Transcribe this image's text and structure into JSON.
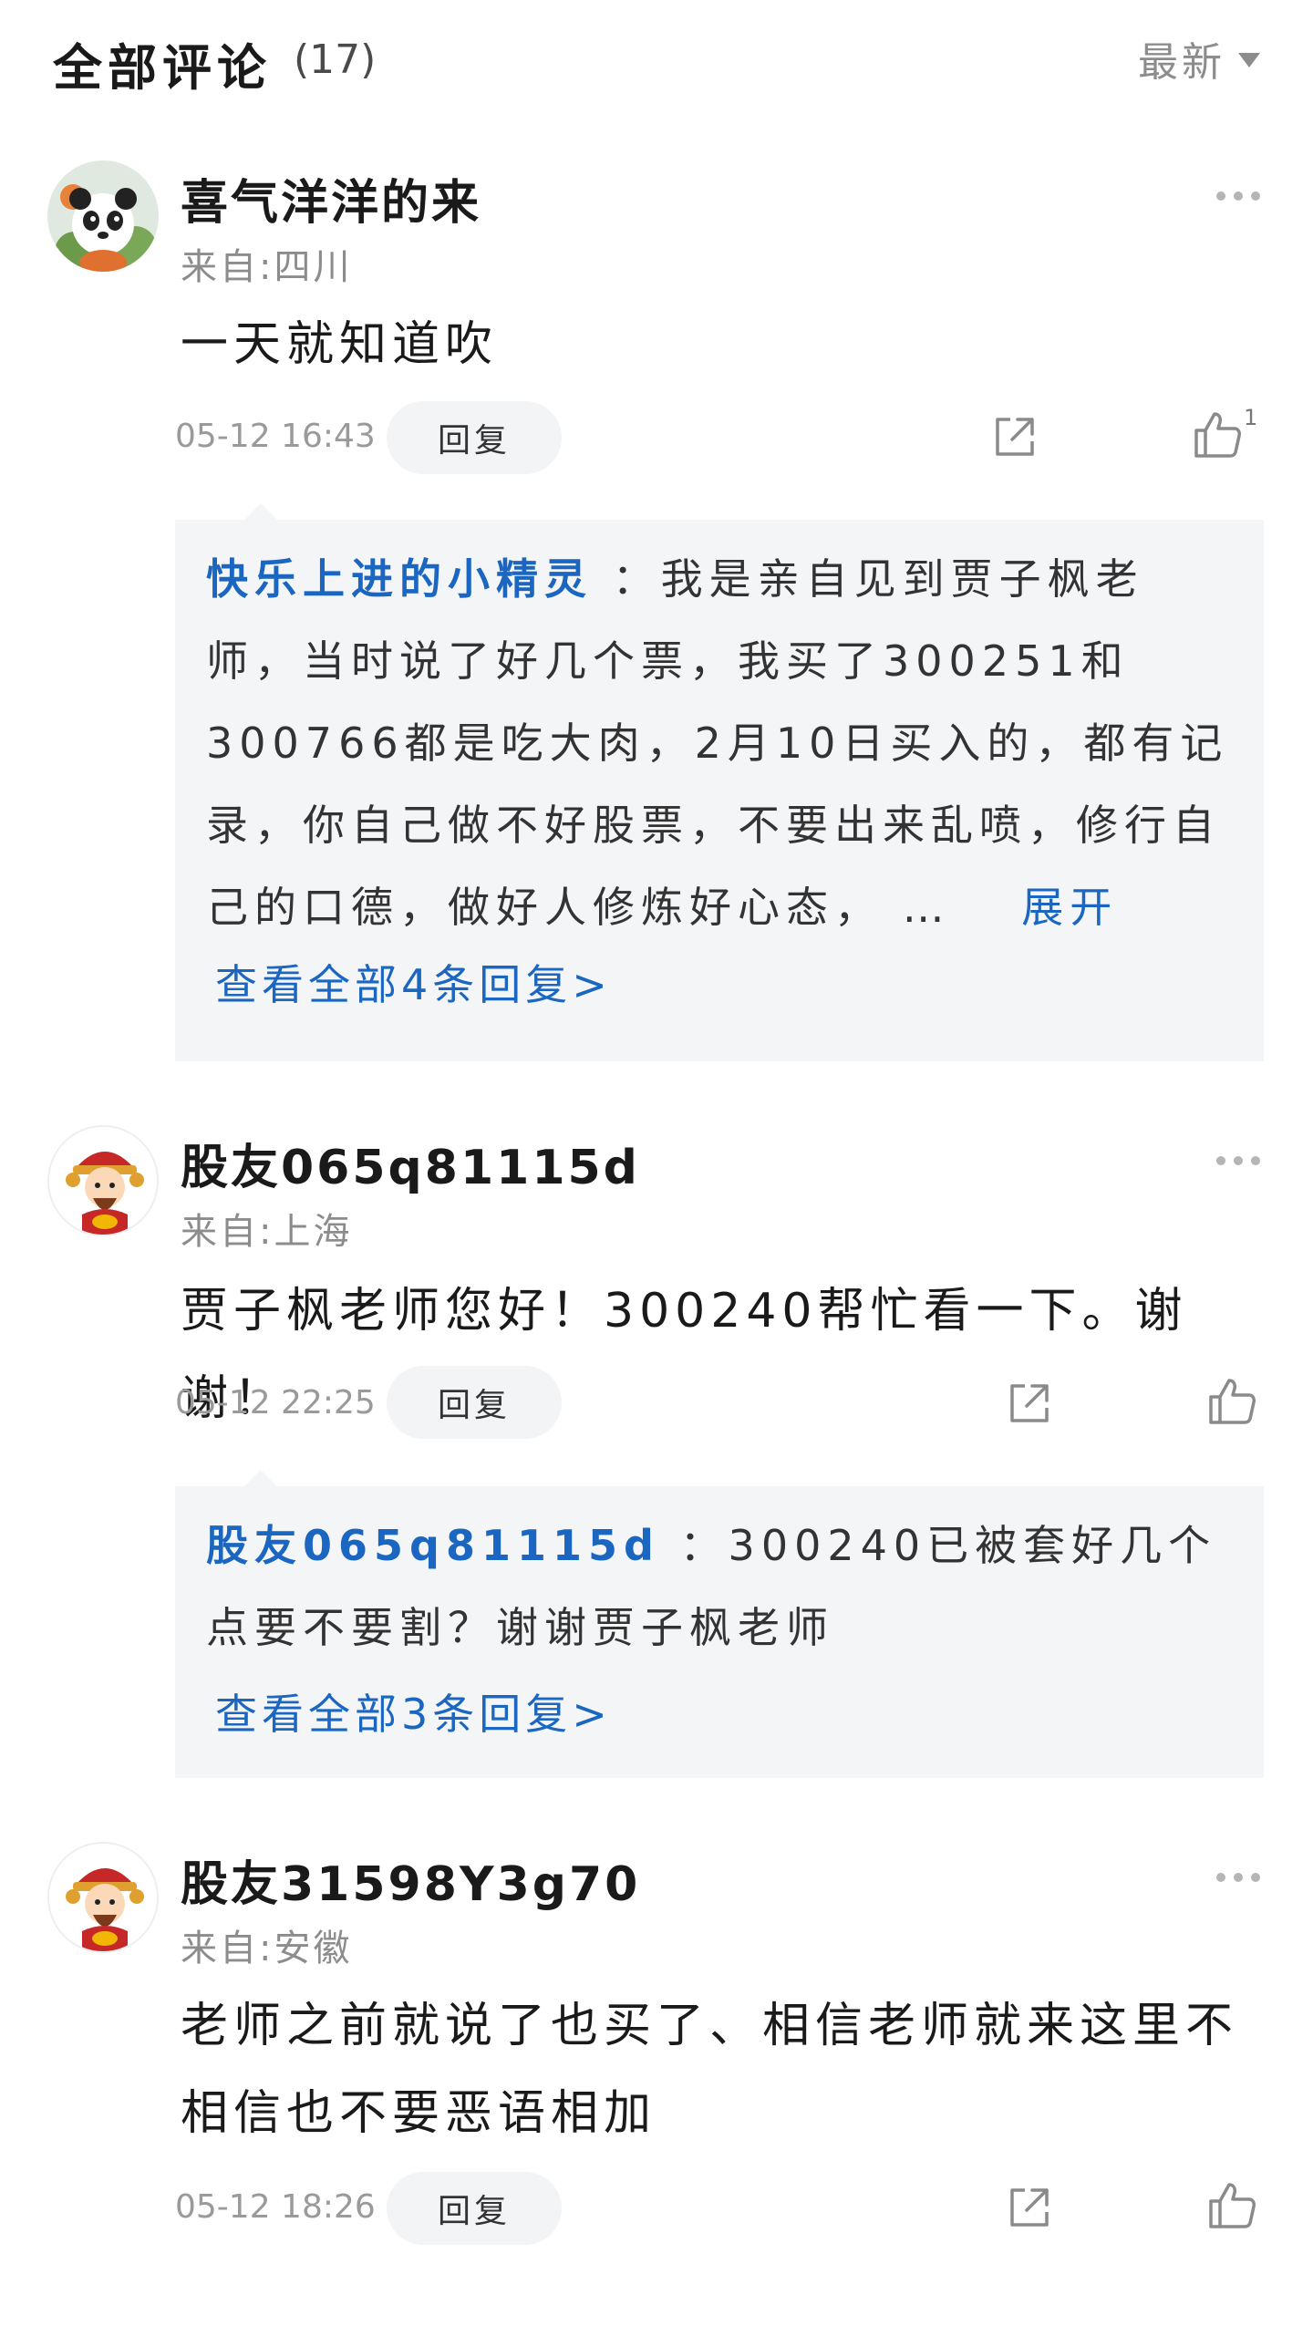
{
  "header": {
    "title": "全部评论",
    "count": "(17)",
    "sort_label": "最新"
  },
  "comments": [
    {
      "username": "喜气洋洋的来",
      "location": "来自:四川",
      "text": "一天就知道吹",
      "date": "05-12  16:43",
      "reply_label": "回复",
      "like_count": "1",
      "reply_preview": {
        "user": "快乐上进的小精灵",
        "text": "：我是亲自见到贾子枫老师，当时说了好几个票，我买了300251和300766都是吃大肉，2月10日买入的，都有记录，你自己做不好股票，不要出来乱喷，修行自己的口德，做好人修炼好心态，  …",
        "expand": "展开",
        "view_all": "查看全部4条回复>"
      }
    },
    {
      "username": "股友065q81115d",
      "location": "来自:上海",
      "text": "贾子枫老师您好！300240帮忙看一下。谢谢！",
      "date": "05-12  22:25",
      "reply_label": "回复",
      "reply_preview": {
        "user": "股友065q81115d",
        "text": "：300240已被套好几个点要不要割？谢谢贾子枫老师",
        "view_all": "查看全部3条回复>"
      }
    },
    {
      "username": "股友31598Y3g70",
      "location": "来自:安徽",
      "text": "老师之前就说了也买了、相信老师就来这里不相信也不要恶语相加",
      "date": "05-12  18:26",
      "reply_label": "回复"
    }
  ],
  "icons": {
    "share": "share-icon",
    "like": "thumbs-up-icon",
    "more": "more-icon",
    "sort": "caret-down-icon"
  },
  "colors": {
    "link_blue": "#1a66c0",
    "reply_bg": "#f4f5f7",
    "muted": "#8c8c8c"
  }
}
